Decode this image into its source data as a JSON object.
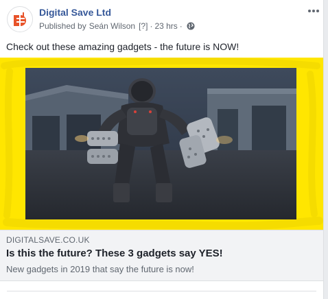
{
  "post": {
    "page_name": "Digital Save Ltd",
    "published_prefix": "Published by",
    "author": "Seán Wilson",
    "help_marker": "[?]",
    "separator": "·",
    "time": "23 hrs",
    "audience_icon": "globe-icon",
    "more_icon": "more-options-icon",
    "text": "Check out these amazing gadgets - the future is NOW!"
  },
  "link_preview": {
    "domain": "DIGITALSAVE.CO.UK",
    "title": "Is this the future? These 3 gadgets say YES!",
    "description": "New gadgets in 2019 that say the future is now!"
  },
  "colors": {
    "page_name": "#365899",
    "highlight": "#ffe600",
    "logo_accent": "#e8532a"
  }
}
